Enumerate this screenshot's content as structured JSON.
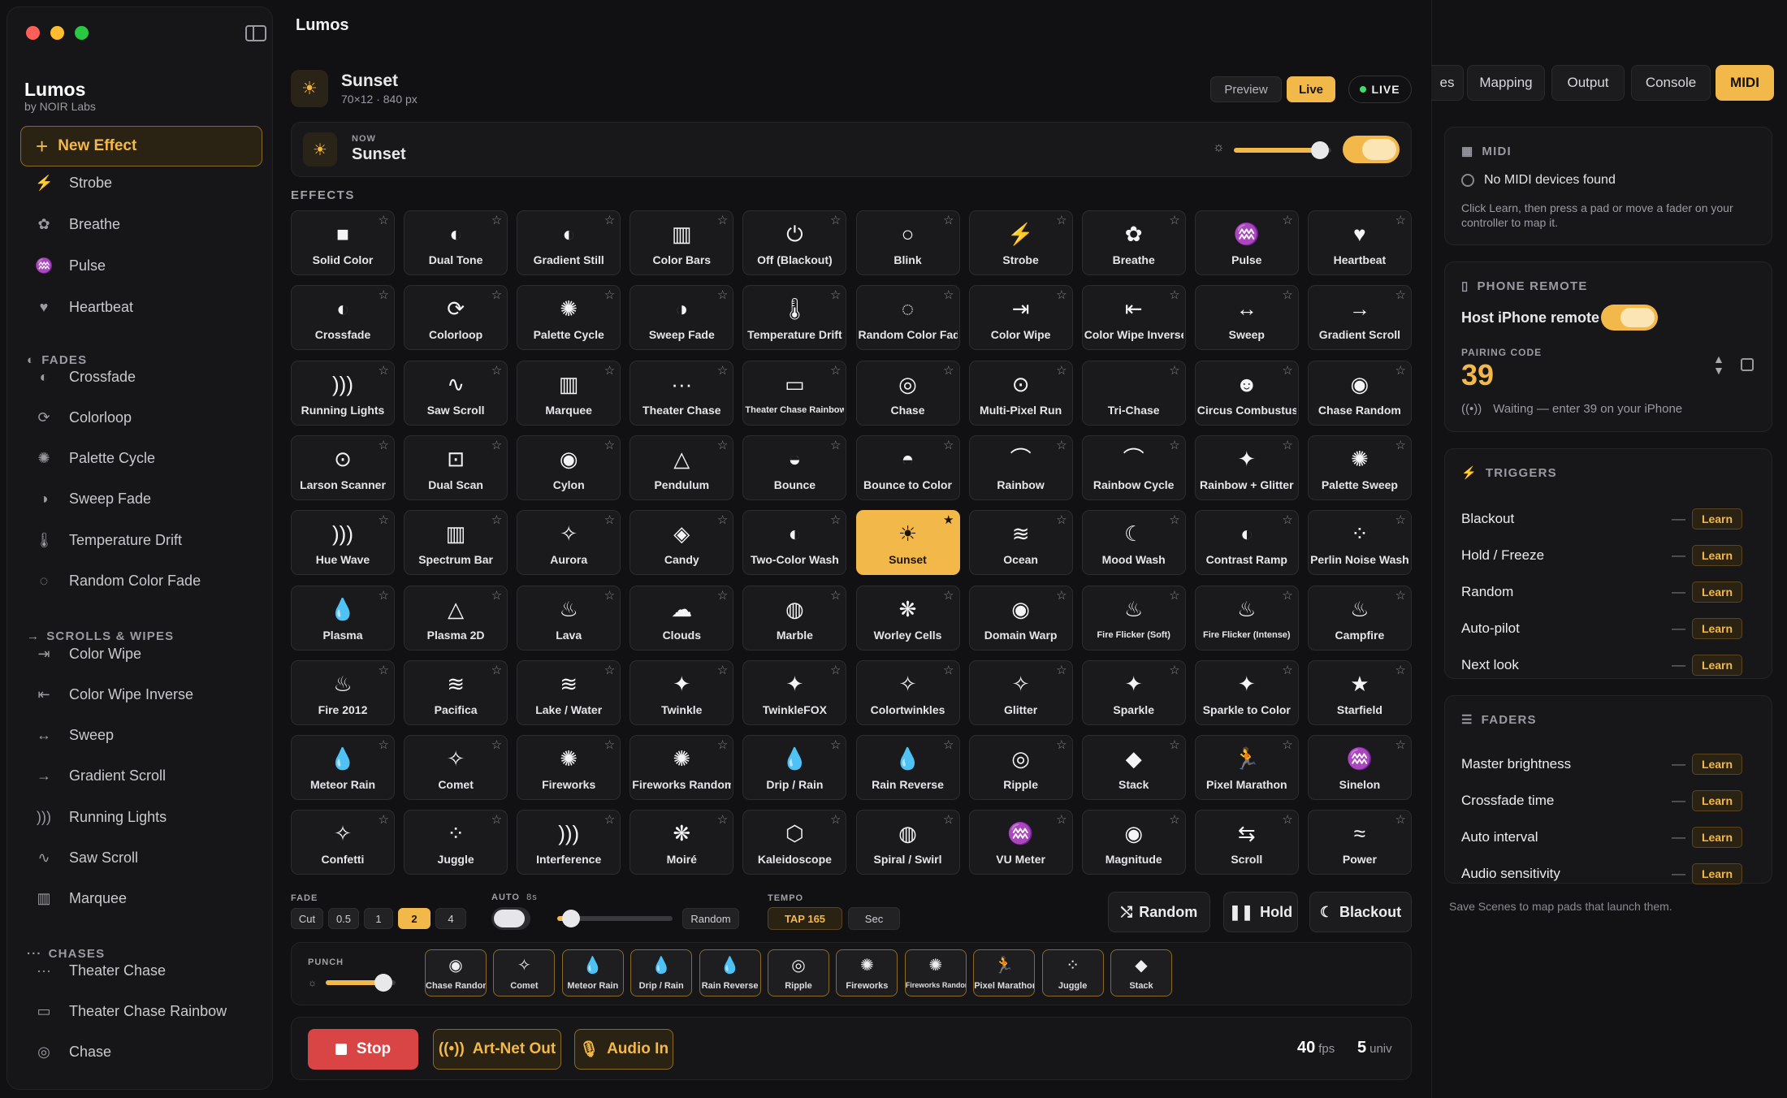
{
  "app": {
    "title": "Lumos",
    "brand": "Lumos",
    "brand_sub": "by NOIR Labs",
    "new_effect": "New Effect"
  },
  "sidebar": {
    "top_items": [
      {
        "icon": "bolt-icon",
        "label": "Strobe"
      },
      {
        "icon": "lungs-icon",
        "label": "Breathe"
      },
      {
        "icon": "waveform-icon",
        "label": "Pulse"
      },
      {
        "icon": "heart-icon",
        "label": "Heartbeat"
      }
    ],
    "sections": [
      {
        "title": "FADES",
        "items": [
          "Crossfade",
          "Colorloop",
          "Palette Cycle",
          "Sweep Fade",
          "Temperature Drift",
          "Random Color Fade"
        ]
      },
      {
        "title": "SCROLLS & WIPES",
        "items": [
          "Color Wipe",
          "Color Wipe Inverse",
          "Sweep",
          "Gradient Scroll",
          "Running Lights",
          "Saw Scroll",
          "Marquee"
        ]
      },
      {
        "title": "CHASES",
        "items": [
          "Theater Chase",
          "Theater Chase Rainbow",
          "Chase"
        ]
      }
    ]
  },
  "header": {
    "scene": "Sunset",
    "sub": "70×12 · 840 px",
    "preview": "Preview",
    "live": "Live",
    "live_badge": "LIVE"
  },
  "now": {
    "label": "NOW",
    "name": "Sunset",
    "brightness": 0.88,
    "enabled": true
  },
  "effects": {
    "title": "EFFECTS",
    "selected": "Sunset",
    "items": [
      [
        "■",
        "Solid Color"
      ],
      [
        "◐",
        "Dual Tone"
      ],
      [
        "◐",
        "Gradient Still"
      ],
      [
        "▥",
        "Color Bars"
      ],
      [
        "⏻",
        "Off (Blackout)"
      ],
      [
        "○",
        "Blink"
      ],
      [
        "⚡",
        "Strobe"
      ],
      [
        "✿",
        "Breathe"
      ],
      [
        "♒",
        "Pulse"
      ],
      [
        "♥",
        "Heartbeat"
      ],
      [
        "◐",
        "Crossfade"
      ],
      [
        "⟳",
        "Colorloop"
      ],
      [
        "✺",
        "Palette Cycle"
      ],
      [
        "◑",
        "Sweep Fade"
      ],
      [
        "🌡",
        "Temperature Drift"
      ],
      [
        "◌",
        "Random Color Fade"
      ],
      [
        "⇥",
        "Color Wipe"
      ],
      [
        "⇤",
        "Color Wipe Inverse"
      ],
      [
        "↔",
        "Sweep"
      ],
      [
        "→",
        "Gradient Scroll"
      ],
      [
        ")))",
        "Running Lights"
      ],
      [
        "∿",
        "Saw Scroll"
      ],
      [
        "▥",
        "Marquee"
      ],
      [
        "···",
        "Theater Chase"
      ],
      [
        "▭",
        "Theater Chase Rainbow"
      ],
      [
        "◎",
        "Chase"
      ],
      [
        "⊙",
        "Multi-Pixel Run"
      ],
      [
        "",
        "Tri-Chase"
      ],
      [
        "☻",
        "Circus Combustus"
      ],
      [
        "◉",
        "Chase Random"
      ],
      [
        "⊙",
        "Larson Scanner"
      ],
      [
        "⊡",
        "Dual Scan"
      ],
      [
        "◉",
        "Cylon"
      ],
      [
        "△",
        "Pendulum"
      ],
      [
        "◒",
        "Bounce"
      ],
      [
        "◓",
        "Bounce to Color"
      ],
      [
        "⌒",
        "Rainbow"
      ],
      [
        "⌒",
        "Rainbow Cycle"
      ],
      [
        "✦",
        "Rainbow + Glitter"
      ],
      [
        "✺",
        "Palette Sweep"
      ],
      [
        ")))",
        "Hue Wave"
      ],
      [
        "▥",
        "Spectrum Bar"
      ],
      [
        "✧",
        "Aurora"
      ],
      [
        "◈",
        "Candy"
      ],
      [
        "◐",
        "Two-Color Wash"
      ],
      [
        "☀",
        "Sunset"
      ],
      [
        "≋",
        "Ocean"
      ],
      [
        "☾",
        "Mood Wash"
      ],
      [
        "◐",
        "Contrast Ramp"
      ],
      [
        "⁘",
        "Perlin Noise Wash"
      ],
      [
        "💧",
        "Plasma"
      ],
      [
        "△",
        "Plasma 2D"
      ],
      [
        "♨",
        "Lava"
      ],
      [
        "☁",
        "Clouds"
      ],
      [
        "◍",
        "Marble"
      ],
      [
        "❋",
        "Worley Cells"
      ],
      [
        "◉",
        "Domain Warp"
      ],
      [
        "♨",
        "Fire Flicker (Soft)"
      ],
      [
        "♨",
        "Fire Flicker (Intense)"
      ],
      [
        "♨",
        "Campfire"
      ],
      [
        "♨",
        "Fire 2012"
      ],
      [
        "≋",
        "Pacifica"
      ],
      [
        "≋",
        "Lake / Water"
      ],
      [
        "✦",
        "Twinkle"
      ],
      [
        "✦",
        "TwinkleFOX"
      ],
      [
        "✧",
        "Colortwinkles"
      ],
      [
        "✧",
        "Glitter"
      ],
      [
        "✦",
        "Sparkle"
      ],
      [
        "✦",
        "Sparkle to Color"
      ],
      [
        "★",
        "Starfield"
      ],
      [
        "💧",
        "Meteor Rain"
      ],
      [
        "✧",
        "Comet"
      ],
      [
        "✺",
        "Fireworks"
      ],
      [
        "✺",
        "Fireworks Random"
      ],
      [
        "💧",
        "Drip / Rain"
      ],
      [
        "💧",
        "Rain Reverse"
      ],
      [
        "◎",
        "Ripple"
      ],
      [
        "◆",
        "Stack"
      ],
      [
        "🏃",
        "Pixel Marathon"
      ],
      [
        "♒",
        "Sinelon"
      ],
      [
        "✧",
        "Confetti"
      ],
      [
        "⁘",
        "Juggle"
      ],
      [
        ")))",
        "Interference"
      ],
      [
        "❋",
        "Moiré"
      ],
      [
        "⬡",
        "Kaleidoscope"
      ],
      [
        "◍",
        "Spiral / Swirl"
      ],
      [
        "♒",
        "VU Meter"
      ],
      [
        "◉",
        "Magnitude"
      ],
      [
        "⇆",
        "Scroll"
      ],
      [
        "≈",
        "Power"
      ]
    ]
  },
  "controls": {
    "fade": {
      "label": "FADE",
      "options": [
        "Cut",
        "0.5",
        "1",
        "2",
        "4"
      ],
      "selected": "2"
    },
    "auto": {
      "label": "AUTO",
      "interval": "8s",
      "random": "Random",
      "level": 0.12
    },
    "tempo": {
      "label": "TEMPO",
      "tap": "TAP 165",
      "sec": "Sec"
    },
    "random_btn": "Random",
    "hold_btn": "Hold",
    "blackout_btn": "Blackout"
  },
  "punch": {
    "label": "PUNCH",
    "level": 0.82,
    "items": [
      [
        "◉",
        "Chase Random"
      ],
      [
        "✧",
        "Comet"
      ],
      [
        "💧",
        "Meteor Rain"
      ],
      [
        "💧",
        "Drip / Rain"
      ],
      [
        "💧",
        "Rain Reverse"
      ],
      [
        "◎",
        "Ripple"
      ],
      [
        "✺",
        "Fireworks"
      ],
      [
        "✺",
        "Fireworks Random"
      ],
      [
        "🏃",
        "Pixel Marathon"
      ],
      [
        "⁘",
        "Juggle"
      ],
      [
        "◆",
        "Stack"
      ]
    ]
  },
  "footer": {
    "stop": "Stop",
    "artnet": "Art-Net Out",
    "audio": "Audio In",
    "fps": "40",
    "fps_unit": "fps",
    "univ": "5",
    "univ_unit": "univ"
  },
  "right": {
    "tabs": [
      "es",
      "Mapping",
      "Output",
      "Console",
      "MIDI"
    ],
    "active_tab": "MIDI",
    "midi": {
      "title": "MIDI",
      "status": "No MIDI devices found",
      "help": "Click Learn, then press a pad or move a fader on your controller to map it."
    },
    "phone": {
      "title": "PHONE REMOTE",
      "host": "Host iPhone remote",
      "pairing_label": "PAIRING CODE",
      "code": "39",
      "waiting": "Waiting — enter 39 on your iPhone"
    },
    "triggers": {
      "title": "TRIGGERS",
      "items": [
        "Blackout",
        "Hold / Freeze",
        "Random",
        "Auto-pilot",
        "Next look"
      ]
    },
    "faders": {
      "title": "FADERS",
      "items": [
        "Master brightness",
        "Crossfade time",
        "Auto interval",
        "Audio sensitivity"
      ]
    },
    "learn": "Learn",
    "dash": "—",
    "footnote": "Save Scenes to map pads that launch them."
  },
  "colors": {
    "accent": "#f3b84a",
    "stop": "#d94545",
    "live_dot": "#3ddc6b"
  }
}
